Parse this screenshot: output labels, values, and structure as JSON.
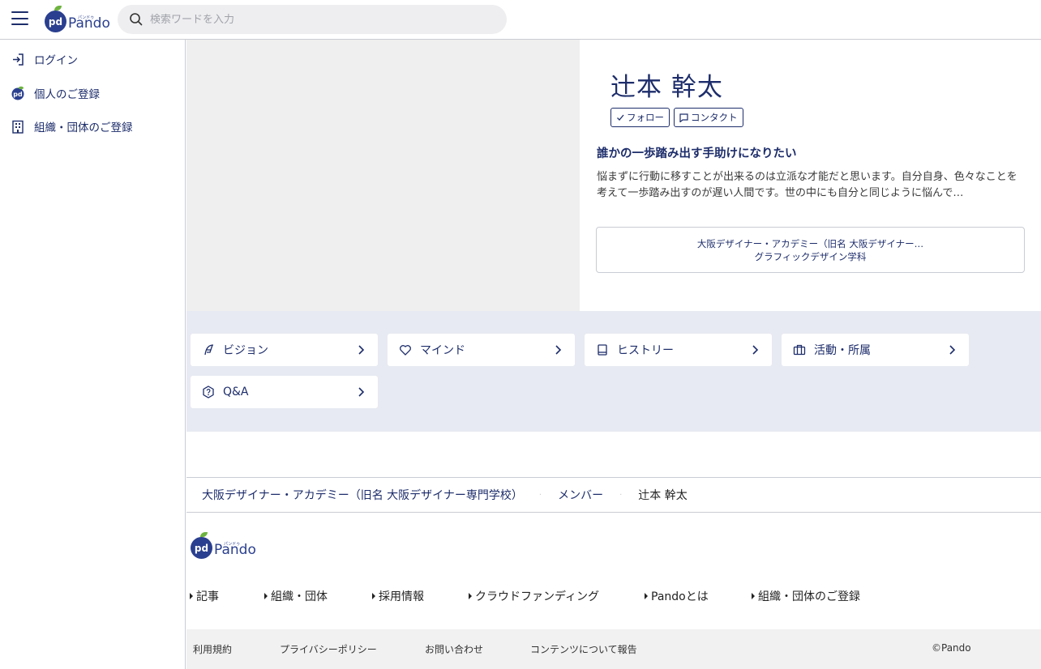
{
  "header": {
    "logo_mark": "pd",
    "logo_text": "Pando",
    "logo_ruby": "パンドゥ",
    "search_placeholder": "検索ワードを入力"
  },
  "sidebar": {
    "items": [
      {
        "label": "ログイン",
        "icon": "login-icon"
      },
      {
        "label": "個人のご登録",
        "icon": "pando-logo-icon"
      },
      {
        "label": "組織・団体のご登録",
        "icon": "building-icon"
      }
    ]
  },
  "profile": {
    "name": "辻本 幹太",
    "follow_label": "フォロー",
    "contact_label": "コンタクト",
    "catchphrase": "誰かの一歩踏み出す手助けになりたい",
    "intro": "悩まずに行動に移すことが出来るのは立派な才能だと思います。自分自身、色々なことを考えて一歩踏み出すのが遅い人間です。世の中にも自分と同じように悩んで…",
    "org_name": "大阪デザイナー・アカデミー（旧名 大阪デザイナー…",
    "org_dept": "グラフィックデザイン学科"
  },
  "tiles": [
    {
      "label": "ビジョン",
      "icon": "feather-icon"
    },
    {
      "label": "マインド",
      "icon": "heart-icon"
    },
    {
      "label": "ヒストリー",
      "icon": "book-icon"
    },
    {
      "label": "活動・所属",
      "icon": "briefcase-icon"
    },
    {
      "label": "Q&A",
      "icon": "qa-icon"
    }
  ],
  "breadcrumb": {
    "org": "大阪デザイナー・アカデミー（旧名 大阪デザイナー専門学校）",
    "members": "メンバー",
    "current": "辻本 幹太"
  },
  "footer": {
    "links": [
      "記事",
      "組織・団体",
      "採用情報",
      "クラウドファンディング",
      "Pandoとは",
      "組織・団体のご登録"
    ],
    "bottom": [
      "利用規約",
      "プライバシーポリシー",
      "お問い合わせ",
      "コンテンツについて報告"
    ],
    "copyright": "©Pando"
  },
  "colors": {
    "brand_navy": "#1d2d6b",
    "tile_bg": "#e7eaf2",
    "leaf_green": "#6db33f"
  }
}
